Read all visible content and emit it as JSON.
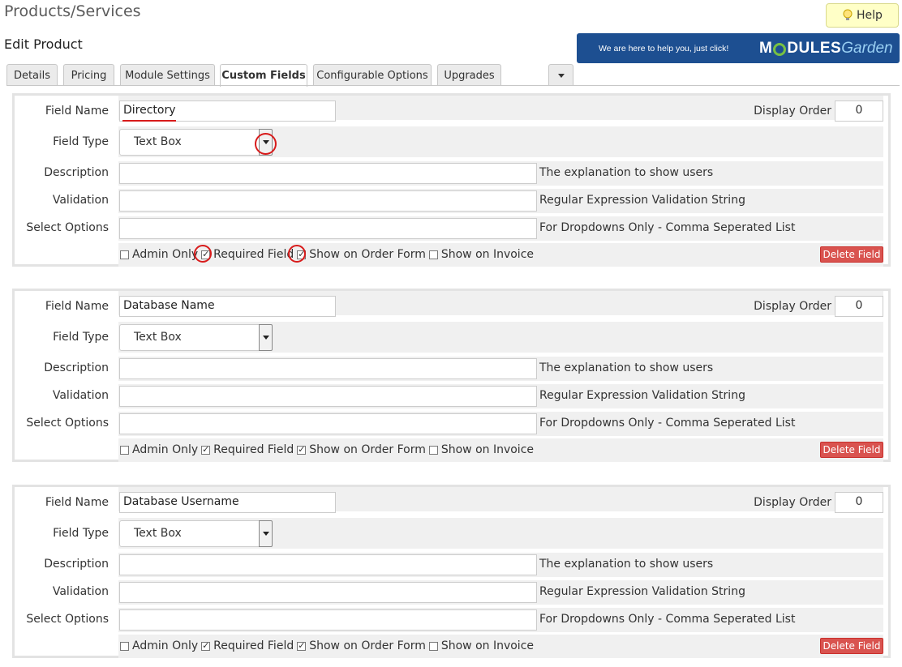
{
  "header": {
    "title": "Products/Services",
    "subtitle": "Edit Product",
    "help_label": "Help"
  },
  "banner": {
    "tagline": "We are here to help you, just click!",
    "logo_part1": "M",
    "logo_part2": "DULES",
    "logo_part3": "Garden"
  },
  "tabs": [
    {
      "label": "Details"
    },
    {
      "label": "Pricing"
    },
    {
      "label": "Module Settings"
    },
    {
      "label": "Custom Fields",
      "active": true
    },
    {
      "label": "Configurable Options"
    },
    {
      "label": "Upgrades"
    }
  ],
  "labels": {
    "field_name": "Field Name",
    "display_order": "Display Order",
    "field_type": "Field Type",
    "description": "Description",
    "validation": "Validation",
    "select_options": "Select Options",
    "description_hint": "The explanation to show users",
    "validation_hint": "Regular Expression Validation String",
    "select_options_hint": "For Dropdowns Only - Comma Seperated List",
    "admin_only": "Admin Only",
    "required_field": "Required Field",
    "show_on_order_form": "Show on Order Form",
    "show_on_invoice": "Show on Invoice",
    "delete_field": "Delete Field"
  },
  "fields": [
    {
      "name": "Directory",
      "display_order": "0",
      "field_type": "Text Box",
      "description": "",
      "validation": "",
      "select_options": "",
      "admin_only": false,
      "required": true,
      "show_on_order_form": true,
      "show_on_invoice": false
    },
    {
      "name": "Database Name",
      "display_order": "0",
      "field_type": "Text Box",
      "description": "",
      "validation": "",
      "select_options": "",
      "admin_only": false,
      "required": true,
      "show_on_order_form": true,
      "show_on_invoice": false
    },
    {
      "name": "Database Username",
      "display_order": "0",
      "field_type": "Text Box",
      "description": "",
      "validation": "",
      "select_options": "",
      "admin_only": false,
      "required": true,
      "show_on_order_form": true,
      "show_on_invoice": false
    }
  ],
  "colors": {
    "annotation": "#d81b1b",
    "delete_button": "#d9534f",
    "banner_bg": "#1d4f91",
    "help_bg": "#ffffc7"
  }
}
